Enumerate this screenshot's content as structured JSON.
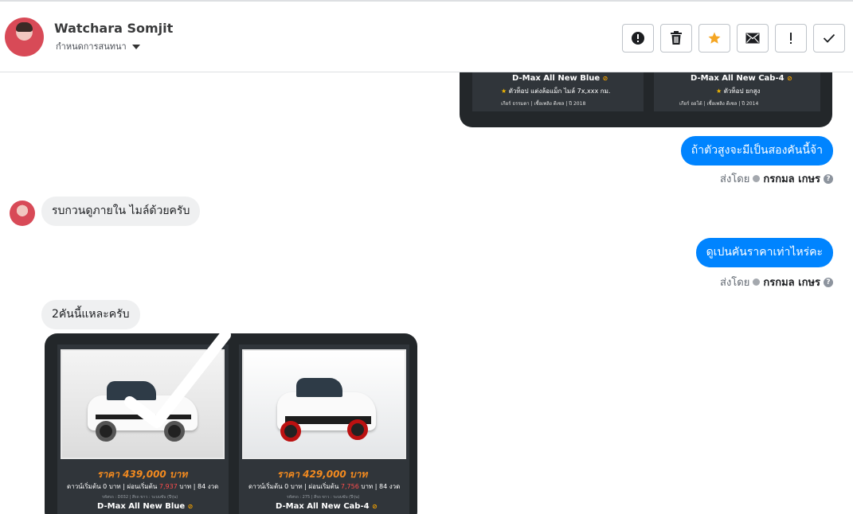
{
  "header": {
    "contact_name": "Watchara Somjit",
    "assign_label": "กำหนดการสนทนา"
  },
  "actions": [
    {
      "name": "mark-spam-button",
      "icon": "alert-circle-icon"
    },
    {
      "name": "delete-button",
      "icon": "trash-icon"
    },
    {
      "name": "star-button",
      "icon": "star-icon"
    },
    {
      "name": "mark-unread-button",
      "icon": "envelope-icon"
    },
    {
      "name": "follow-up-button",
      "icon": "exclamation-icon"
    },
    {
      "name": "mark-done-button",
      "icon": "checkmark-icon"
    }
  ],
  "messages": {
    "m1": {
      "text": "ถ้าตัวสูงจะมีเป็นสองคันนี้จ้า",
      "sent_by_label": "ส่งโดย",
      "sender": "กรกมล เกษร"
    },
    "m2": {
      "text": "รบกวนดูภายใน ไมล์ด้วยครับ"
    },
    "m3": {
      "text": "ดูเปนคันราคาเท่าไหร่คะ",
      "sent_by_label": "ส่งโดย",
      "sender": "กรกมล เกษร"
    },
    "m4": {
      "text": "2คันนี้แหละครับ"
    }
  },
  "top_card": {
    "left": {
      "model": "D-Max All New Blue",
      "feature": "ตัวท็อป แต่งล้อแม็ก ไมล์ 7x,xxx กม.",
      "specs": "เกียร์ ธรรมดา   |   เชื้อเพลิง ดีเซล   |   ปี 2018"
    },
    "right": {
      "model": "D-Max All New Cab-4",
      "feature": "ตัวท็อป ยกสูง",
      "specs": "เกียร์ ออโต้   |   เชื้อเพลิง ดีเซล   |   ปี 2014"
    }
  },
  "bottom_card": {
    "left": {
      "price": "ราคา 439,000 บาท",
      "down_a": "ดาวน์เริ่มต้น 0 บาท | ผ่อนเริ่มต้น",
      "installment": "7,937",
      "down_b": "บาท | 84 งวด",
      "tiny": "รหัสรถ : D032 | สีรถ ขาว : ระบบขับ (ปีรุ่น)",
      "model": "D-Max All New Blue"
    },
    "right": {
      "price": "ราคา 429,000 บาท",
      "down_a": "ดาวน์เริ่มต้น 0 บาท | ผ่อนเริ่มต้น",
      "installment": "7,756",
      "down_b": "บาท | 84 งวด",
      "tiny": "รหัสรถ : 275 | สีรถ ขาว : ระบบขับ (ปีรุ่น)",
      "model": "D-Max All New Cab-4"
    }
  },
  "colors": {
    "messenger_blue": "#0084ff",
    "incoming_bubble": "#eff0f1",
    "price_orange": "#f28a1f",
    "star_orange": "#f5a623"
  }
}
